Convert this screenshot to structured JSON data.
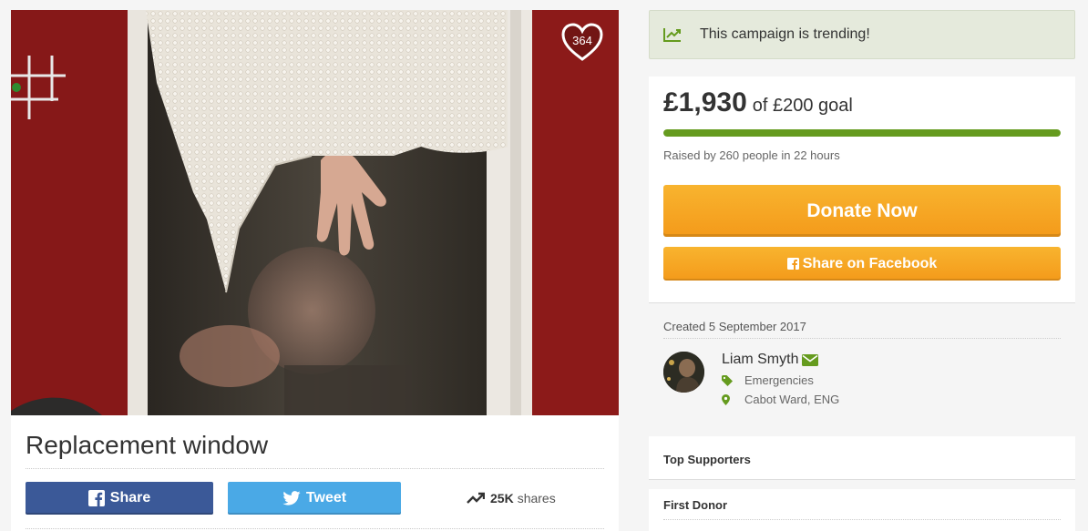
{
  "campaign": {
    "title": "Replacement window",
    "hearts": "364",
    "image_alt": "Photo of a person stuck in a bathroom window"
  },
  "social": {
    "share_label": "Share",
    "tweet_label": "Tweet",
    "shares_count": "25K",
    "shares_word": "shares"
  },
  "trending": {
    "text": "This campaign is trending!",
    "icon": "trending-chart-icon"
  },
  "donation": {
    "amount": "£1,930",
    "goal_text": "of £200 goal",
    "progress_fraction": 1.0,
    "raised_by": "Raised by 260 people in 22 hours",
    "donate_label": "Donate Now",
    "facebook_label": "Share on Facebook"
  },
  "details": {
    "created": "Created 5 September 2017",
    "organizer_name": "Liam Smyth",
    "category": "Emergencies",
    "location": "Cabot Ward, ENG"
  },
  "panels": {
    "top_supporters": "Top Supporters",
    "first_donor": "First Donor"
  },
  "colors": {
    "accent_green": "#659b1e",
    "donate_orange": "#f49a1a",
    "facebook_blue": "#3b5998",
    "twitter_blue": "#4aa9e6"
  }
}
